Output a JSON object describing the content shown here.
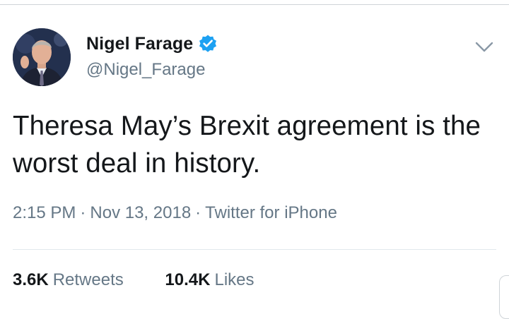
{
  "tweet": {
    "author": {
      "display_name": "Nigel Farage",
      "handle": "@Nigel_Farage",
      "verified": true
    },
    "text": "Theresa May’s Brexit agreement is the worst deal in history.",
    "time": "2:15 PM",
    "date": "Nov 13, 2018",
    "source": "Twitter for iPhone",
    "separator": "·",
    "stats": {
      "retweets_count": "3.6K",
      "retweets_label": "Retweets",
      "likes_count": "10.4K",
      "likes_label": "Likes"
    }
  },
  "icons": {
    "verified": "verified-badge-icon",
    "menu": "chevron-down-icon"
  },
  "colors": {
    "verified_blue": "#1da1f2",
    "secondary_text": "#657786",
    "primary_text": "#14171a",
    "divider": "#e1e8ed"
  }
}
